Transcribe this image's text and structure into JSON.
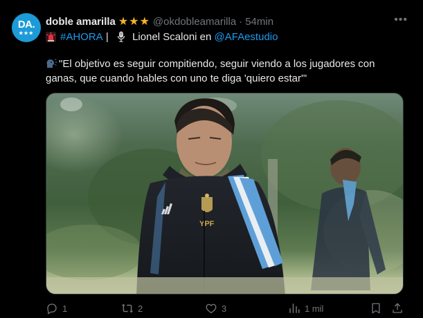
{
  "author": {
    "avatar_text": "DA.",
    "avatar_stars": "★★★",
    "display_name": "doble amarilla",
    "badges": "★★★",
    "handle": "@okdobleamarilla",
    "separator": "·",
    "time": "54min"
  },
  "header_line": {
    "hashtag": "#AHORA",
    "pipe": " | ",
    "speaker_text": " Lionel Scaloni en ",
    "mention": "@AFAestudio"
  },
  "body": {
    "quote": "\"El objetivo es seguir compitiendo, seguir viendo a los jugadores con ganas, que cuando hables con uno te diga 'quiero estar'\""
  },
  "media": {
    "jacket_text": "YPF",
    "jacket_brand": "adidas"
  },
  "actions": {
    "replies": "1",
    "retweets": "2",
    "likes": "3",
    "views": "1 mil"
  },
  "colors": {
    "background": "#000000",
    "text": "#e7e9ea",
    "muted": "#71767b",
    "link": "#1d9bf0",
    "avatar": "#1d9bd8",
    "badge": "#f5b325"
  },
  "icons": [
    "more-icon",
    "siren-icon",
    "microphone-icon",
    "speaking-head-icon",
    "reply-icon",
    "retweet-icon",
    "like-icon",
    "views-icon",
    "bookmark-icon",
    "share-icon"
  ]
}
